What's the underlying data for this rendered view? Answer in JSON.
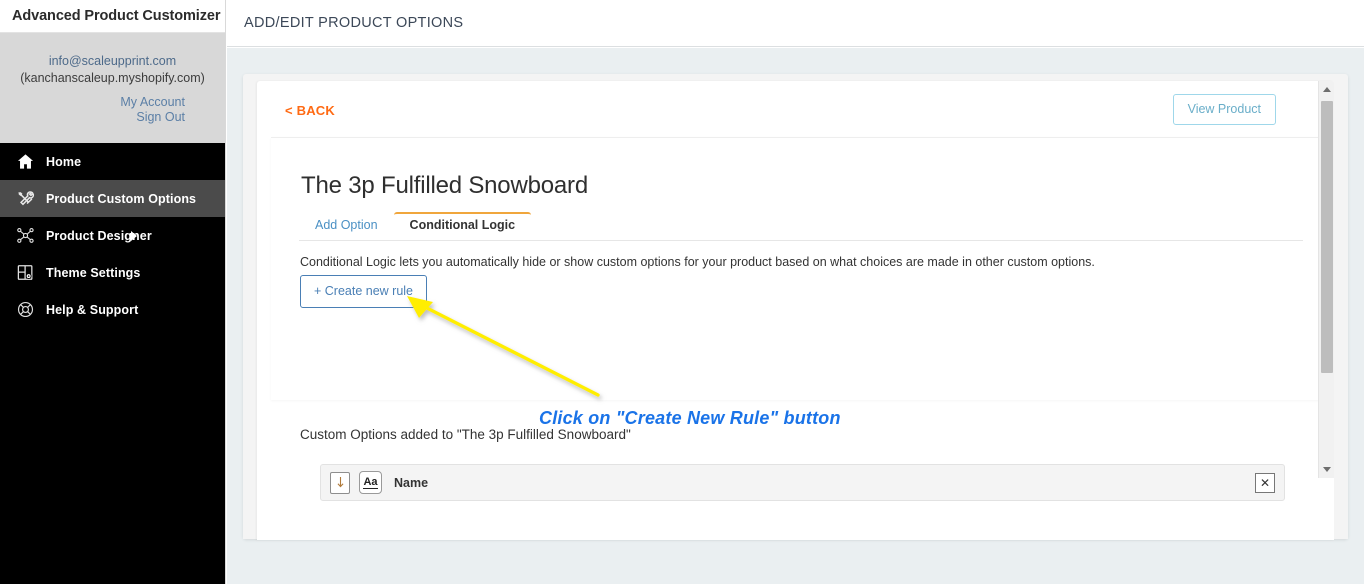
{
  "sidebar": {
    "brand_title": "Advanced Product Customizer",
    "account": {
      "email": "info@scaleupprint.com",
      "shop": "(kanchanscaleup.myshopify.com)",
      "my_account_label": "My Account",
      "sign_out_label": "Sign Out"
    },
    "items": [
      {
        "label": "Home",
        "icon": "home-icon",
        "active": false,
        "has_caret": false
      },
      {
        "label": "Product Custom Options",
        "icon": "tools-icon",
        "active": true,
        "has_caret": false
      },
      {
        "label": "Product Designer",
        "icon": "nodes-icon",
        "active": false,
        "has_caret": true
      },
      {
        "label": "Theme Settings",
        "icon": "layout-gear-icon",
        "active": false,
        "has_caret": false
      },
      {
        "label": "Help & Support",
        "icon": "lifebuoy-icon",
        "active": false,
        "has_caret": false
      }
    ]
  },
  "topbar": {
    "title": "ADD/EDIT PRODUCT OPTIONS"
  },
  "card": {
    "back_label": "< BACK",
    "view_product_label": "View Product",
    "product_title": "The 3p Fulfilled Snowboard",
    "tabs": [
      {
        "label": "Add Option",
        "active": false
      },
      {
        "label": "Conditional Logic",
        "active": true
      }
    ],
    "conditional_logic_description": "Conditional Logic lets you automatically hide or show custom options for your product based on what choices are made in other custom options.",
    "create_rule_label": "+ Create new rule",
    "options_heading": "Custom Options added to \"The 3p Fulfilled Snowboard\"",
    "options": [
      {
        "label": "Name",
        "type_icon": "Aa",
        "remove_label": "✕"
      }
    ]
  },
  "annotation": {
    "text": "Click on \"Create New Rule\" button",
    "arrow_color": "#ffee00",
    "text_color": "#1a73e8"
  },
  "colors": {
    "accent_orange": "#ff6a13",
    "tab_underline": "#f0a63c",
    "link_blue": "#4a90c4",
    "sidebar_bg": "#000000",
    "sidebar_active": "#4b4b4b",
    "content_bg": "#eaeff1"
  }
}
